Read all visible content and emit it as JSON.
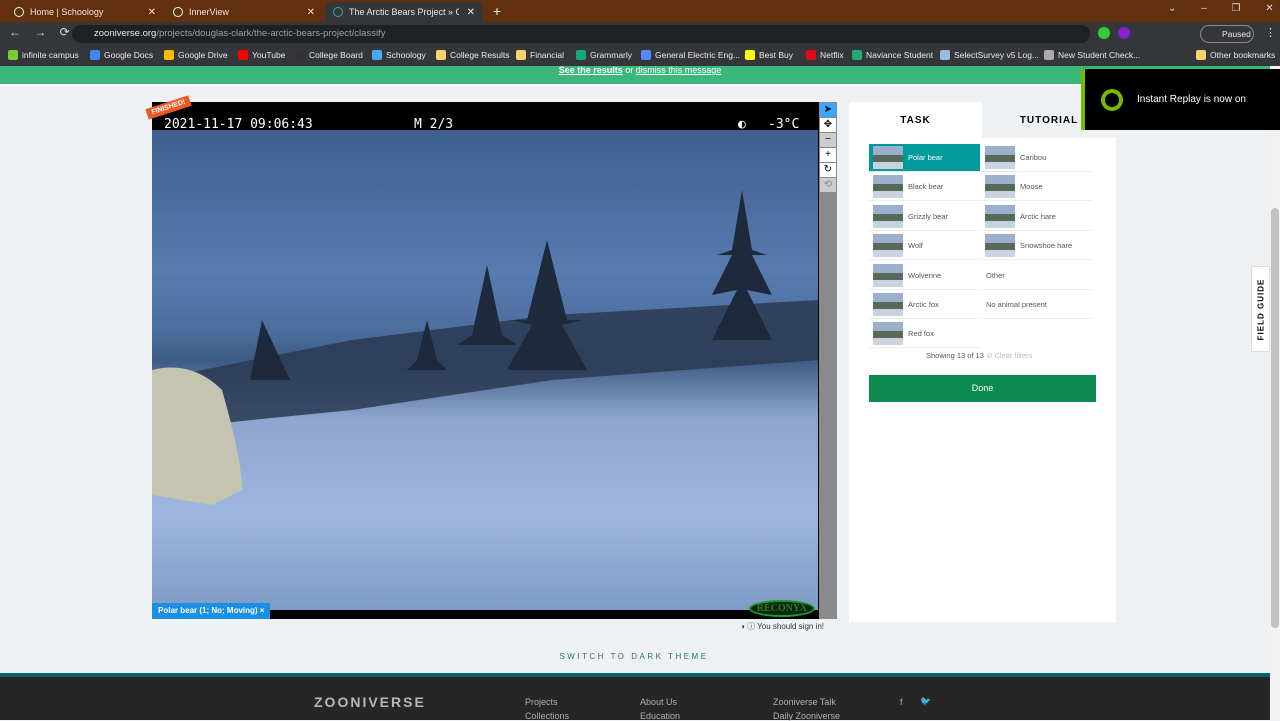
{
  "browser": {
    "tabs": [
      {
        "title": "Home | Schoology"
      },
      {
        "title": "InnerView"
      },
      {
        "title": "The Arctic Bears Project » Classify"
      }
    ],
    "url_host": "zooniverse.org",
    "url_path": "/projects/douglas-clark/the-arctic-bears-project/classify",
    "profile_status": "Paused",
    "bookmarks": [
      "infinite campus",
      "Google Docs",
      "Google Drive",
      "YouTube",
      "College Board",
      "Schoology",
      "College Results",
      "Financial",
      "Grammarly",
      "General Electric Eng...",
      "Best Buy",
      "Netflix",
      "Naviance Student",
      "SelectSurvey v5 Log...",
      "New Student Check...",
      "Other bookmarks"
    ]
  },
  "banner": {
    "link1": "See the results",
    "mid": " or ",
    "link2": "dismiss this message"
  },
  "viewer": {
    "finished_badge": "FINISHED!",
    "timestamp": "2021-11-17 09:06:43",
    "frame": "M 2/3",
    "temperature": "-3°C",
    "annotation": "Polar bear (1; No; Moving)",
    "annotation_close": "×",
    "camera_brand": "RECONYX",
    "signin": "You should sign in!"
  },
  "task": {
    "tabs": [
      "TASK",
      "TUTORIAL"
    ],
    "choices_left": [
      "Polar bear",
      "Black bear",
      "Grizzly bear",
      "Wolf",
      "Wolverine",
      "Arctic fox",
      "Red fox"
    ],
    "choices_right": [
      "Caribou",
      "Moose",
      "Arctic hare",
      "Snowshoe hare",
      "Other",
      "No animal present"
    ],
    "selected": "Polar bear",
    "showing": "Showing 13 of 13",
    "clear_filters": "Clear filters",
    "done": "Done"
  },
  "field_guide": "FIELD GUIDE",
  "overlay": {
    "instant_replay": "Instant Replay is now on"
  },
  "switch_theme": "SWITCH TO DARK THEME",
  "footer": {
    "logo": "ZOONIVERSE",
    "col1": [
      "Projects",
      "Collections"
    ],
    "col2": [
      "About Us",
      "Education"
    ],
    "col3": [
      "Zooniverse Talk",
      "Daily Zooniverse"
    ],
    "social": [
      "f",
      "twitter"
    ]
  }
}
